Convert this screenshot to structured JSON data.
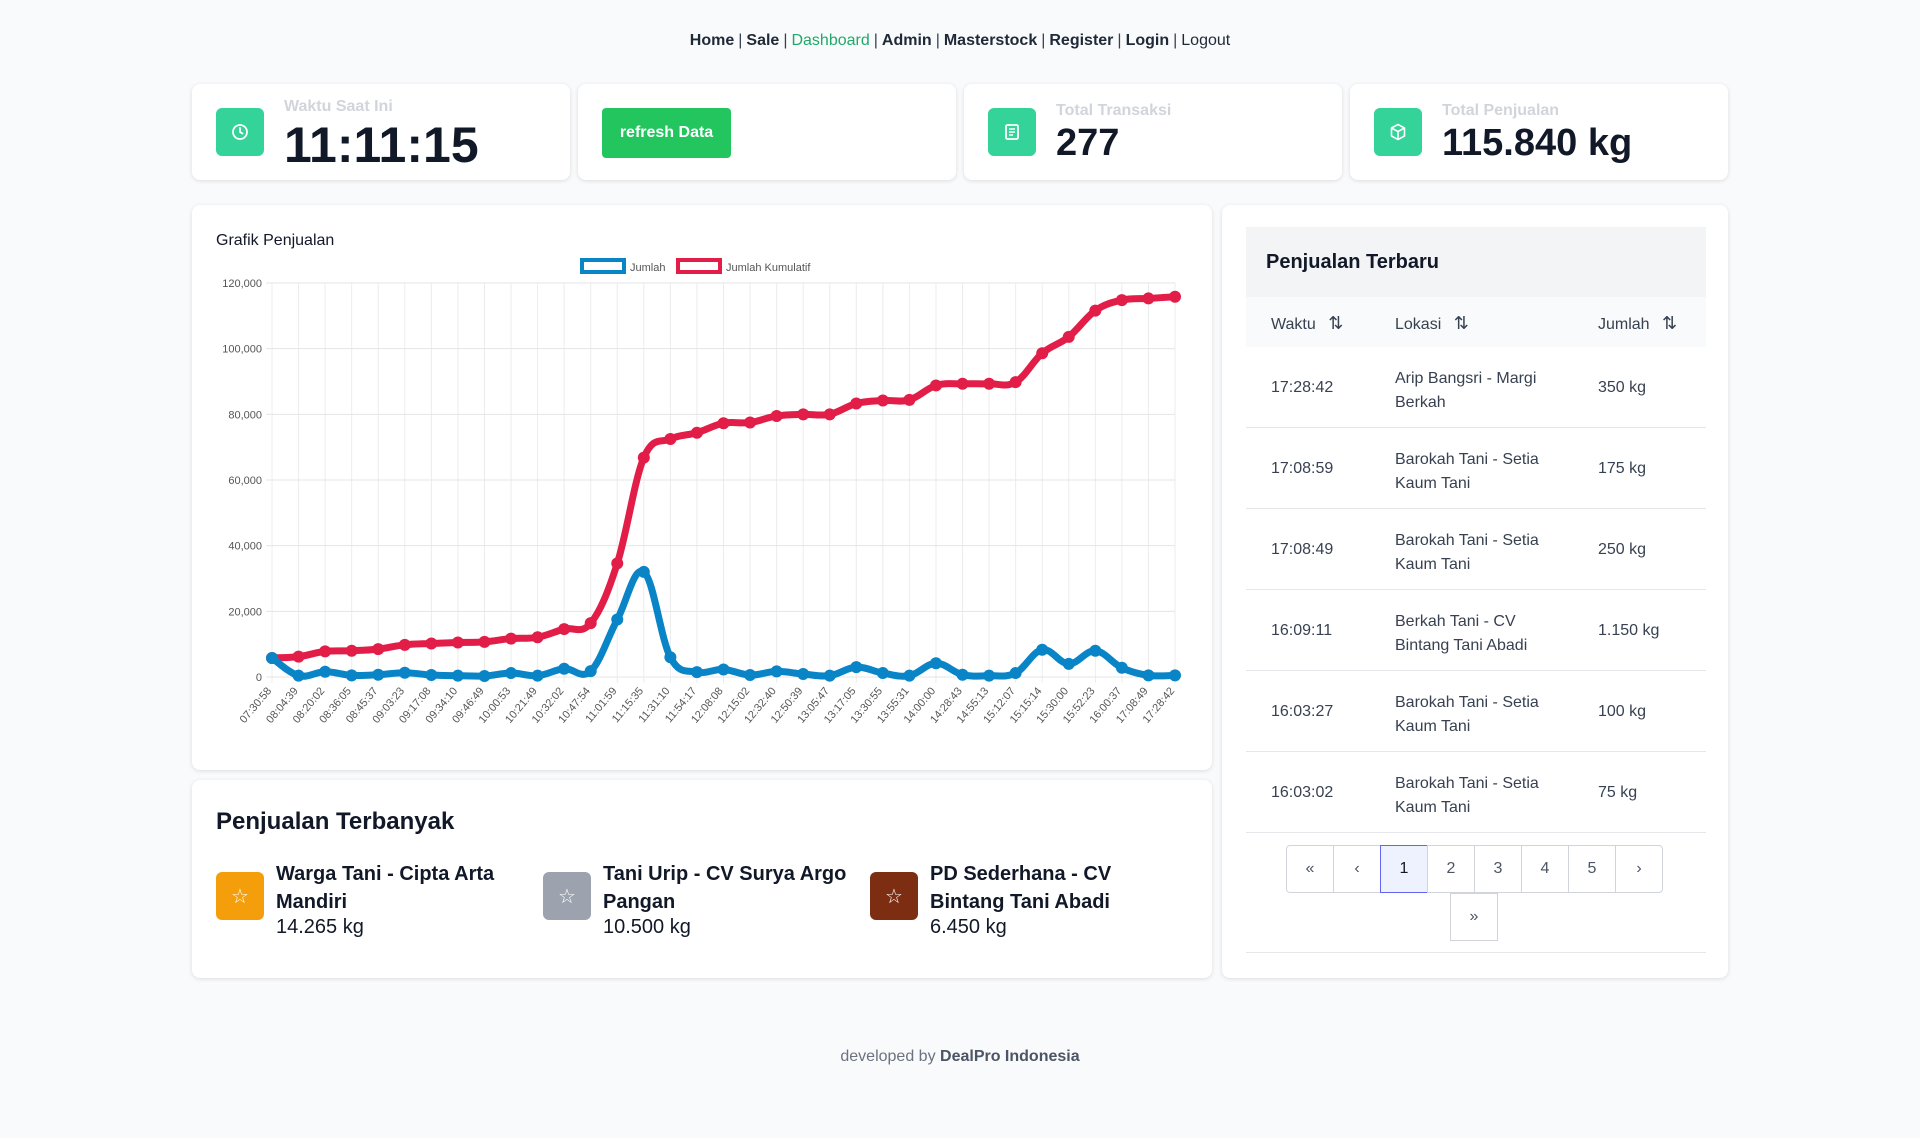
{
  "nav": {
    "items": [
      "Home",
      "Sale",
      "Dashboard",
      "Admin",
      "Masterstock",
      "Register",
      "Login",
      "Logout"
    ],
    "active": "Dashboard"
  },
  "stats": {
    "clock": {
      "label": "Waktu Saat Ini",
      "value": "11:11:15"
    },
    "refresh_label": "refresh Data",
    "transactions": {
      "label": "Total Transaksi",
      "value": "277"
    },
    "sales": {
      "label": "Total Penjualan",
      "value": "115.840 kg"
    }
  },
  "chart_data": {
    "type": "line",
    "title": "Grafik Penjualan",
    "xlabel": "",
    "ylabel": "",
    "ylim": [
      0,
      120000
    ],
    "yticks": [
      "0",
      "20,000",
      "40,000",
      "60,000",
      "80,000",
      "100,000",
      "120,000"
    ],
    "grid": true,
    "legend_position": "top",
    "categories": [
      "07:30:58",
      "08:04:39",
      "08:20:02",
      "08:36:05",
      "08:45:37",
      "09:03:23",
      "09:17:08",
      "09:34:10",
      "09:46:49",
      "10:00:53",
      "10:21:49",
      "10:32:02",
      "10:47:54",
      "11:01:59",
      "11:15:35",
      "11:31:10",
      "11:54:17",
      "12:08:08",
      "12:15:02",
      "12:32:40",
      "12:50:39",
      "13:05:47",
      "13:17:05",
      "13:30:55",
      "13:55:31",
      "14:00:00",
      "14:28:43",
      "14:55:13",
      "15:12:07",
      "15:15:14",
      "15:30:00",
      "15:52:23",
      "16:00:37",
      "17:08:49",
      "17:28:42"
    ],
    "series": [
      {
        "name": "Jumlah",
        "color": "#0984c7",
        "values": [
          5800,
          400,
          1600,
          500,
          700,
          1300,
          600,
          400,
          300,
          1200,
          400,
          2500,
          1800,
          17500,
          32000,
          6000,
          1500,
          2300,
          600,
          1700,
          900,
          400,
          3000,
          1200,
          400,
          4200,
          700,
          400,
          1200,
          8300,
          4000,
          8000,
          2800,
          500,
          500
        ]
      },
      {
        "name": "Jumlah Kumulatif",
        "color": "#e11d48",
        "values": [
          5800,
          6200,
          7800,
          8000,
          8500,
          9800,
          10200,
          10500,
          10700,
          11700,
          12100,
          14600,
          16400,
          34600,
          66800,
          72500,
          74400,
          77300,
          77500,
          79500,
          80000,
          80000,
          83300,
          84200,
          84400,
          88800,
          89300,
          89300,
          89800,
          98600,
          103600,
          111600,
          114800,
          115300,
          115800
        ]
      }
    ]
  },
  "recent": {
    "title": "Penjualan Terbaru",
    "columns": [
      "Waktu",
      "Lokasi",
      "Jumlah"
    ],
    "rows": [
      {
        "time": "17:28:42",
        "location": "Arip Bangsri - Margi Berkah",
        "qty": "350 kg"
      },
      {
        "time": "17:08:59",
        "location": "Barokah Tani - Setia Kaum Tani",
        "qty": "175 kg"
      },
      {
        "time": "17:08:49",
        "location": "Barokah Tani - Setia Kaum Tani",
        "qty": "250 kg"
      },
      {
        "time": "16:09:11",
        "location": "Berkah Tani - CV Bintang Tani Abadi",
        "qty": "1.150 kg"
      },
      {
        "time": "16:03:27",
        "location": "Barokah Tani - Setia Kaum Tani",
        "qty": "100 kg"
      },
      {
        "time": "16:03:02",
        "location": "Barokah Tani - Setia Kaum Tani",
        "qty": "75 kg"
      }
    ],
    "pages": [
      "1",
      "2",
      "3",
      "4",
      "5"
    ],
    "current_page": "1"
  },
  "top_sales": {
    "title": "Penjualan Terbanyak",
    "items": [
      {
        "name": "Warga Tani - Cipta Arta Mandiri",
        "qty": "14.265 kg",
        "color": "#f59e0b"
      },
      {
        "name": "Tani Urip - CV Surya Argo Pangan",
        "qty": "10.500 kg",
        "color": "#9ca3af"
      },
      {
        "name": "PD Sederhana - CV Bintang Tani Abadi",
        "qty": "6.450 kg",
        "color": "#7c2d12"
      }
    ]
  },
  "footer": {
    "prefix": "developed by",
    "brand": "DealPro Indonesia"
  }
}
